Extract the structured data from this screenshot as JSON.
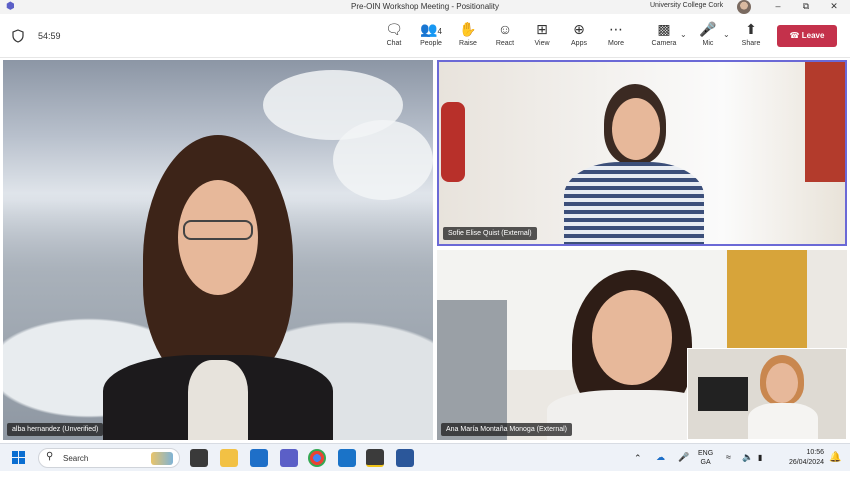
{
  "window": {
    "title": "Pre-OIN Workshop Meeting - Positionality",
    "organization": "University College Cork",
    "minimize": "–",
    "maximize": "⧉",
    "close": "✕"
  },
  "toolbar": {
    "timer": "54:59",
    "chat": "Chat",
    "people": "People",
    "people_count": "4",
    "raise": "Raise",
    "react": "React",
    "view": "View",
    "apps": "Apps",
    "more": "More",
    "camera": "Camera",
    "mic": "Mic",
    "share": "Share",
    "leave": "Leave",
    "leave_color": "#c4314b"
  },
  "participants": {
    "main": "alba hernandez (Unverified)",
    "top_right": "Sofie Elise Quist (External)",
    "bottom_right": "Ana María Montaña Monoga (External)"
  },
  "taskbar": {
    "search_placeholder": "Search",
    "lang_top": "ENG",
    "lang_bottom": "GA",
    "time": "10:56",
    "date": "26/04/2024"
  }
}
